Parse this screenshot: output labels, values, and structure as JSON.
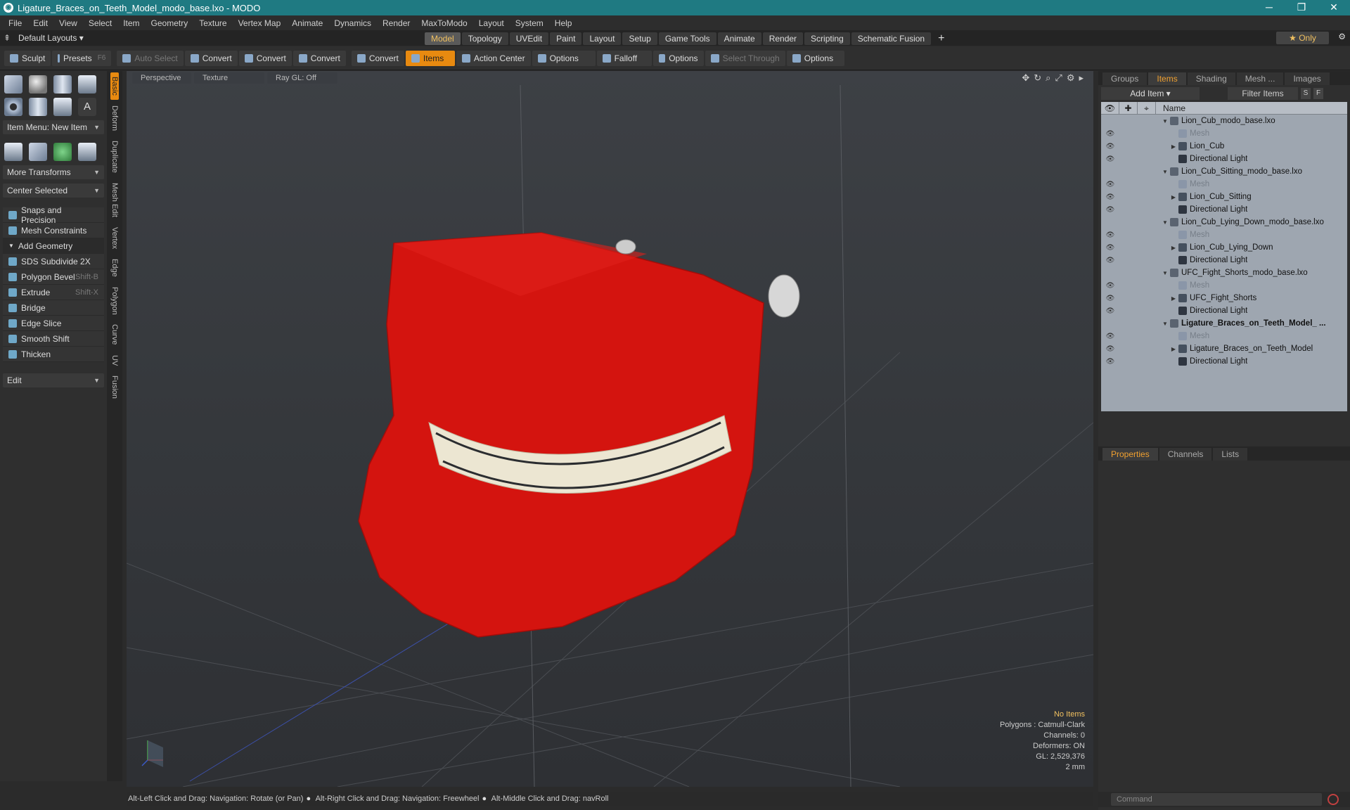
{
  "window": {
    "title": "Ligature_Braces_on_Teeth_Model_modo_base.lxo - MODO"
  },
  "menu": [
    "File",
    "Edit",
    "View",
    "Select",
    "Item",
    "Geometry",
    "Texture",
    "Vertex Map",
    "Animate",
    "Dynamics",
    "Render",
    "MaxToModo",
    "Layout",
    "System",
    "Help"
  ],
  "layouts": {
    "default_label": "Default Layouts"
  },
  "tabs": [
    "Model",
    "Topology",
    "UVEdit",
    "Paint",
    "Layout",
    "Setup",
    "Game Tools",
    "Animate",
    "Render",
    "Scripting",
    "Schematic Fusion"
  ],
  "only_label": "Only",
  "toolbar": {
    "sculpt": "Sculpt",
    "presets": "Presets",
    "presets_hk": "F6",
    "auto_select": "Auto Select",
    "convert1": "Convert",
    "convert2": "Convert",
    "convert3": "Convert",
    "convert4": "Convert",
    "items": "Items",
    "action_center": "Action Center",
    "options1": "Options",
    "falloff": "Falloff",
    "options2": "Options",
    "select_through": "Select Through",
    "options3": "Options"
  },
  "left": {
    "item_menu": "Item Menu: New Item",
    "more_transforms": "More Transforms",
    "center_selected": "Center Selected",
    "snaps": "Snaps and Precision",
    "mesh_constraints": "Mesh Constraints",
    "add_geometry": "Add Geometry",
    "tools": [
      {
        "label": "SDS Subdivide 2X",
        "hk": ""
      },
      {
        "label": "Polygon Bevel",
        "hk": "Shift-B"
      },
      {
        "label": "Extrude",
        "hk": "Shift-X"
      },
      {
        "label": "Bridge",
        "hk": ""
      },
      {
        "label": "Edge Slice",
        "hk": ""
      },
      {
        "label": "Smooth Shift",
        "hk": ""
      },
      {
        "label": "Thicken",
        "hk": ""
      }
    ],
    "edit": "Edit"
  },
  "sidetabs": [
    "Basic",
    "Deform",
    "Duplicate",
    "Mesh Edit",
    "Vertex",
    "Edge",
    "Polygon",
    "Curve",
    "UV",
    "Fusion"
  ],
  "viewport": {
    "perspective": "Perspective",
    "texture": "Texture",
    "raygl": "Ray GL: Off",
    "info": {
      "no_items": "No Items",
      "polygons": "Polygons : Catmull-Clark",
      "channels": "Channels: 0",
      "deformers": "Deformers: ON",
      "gl": "GL: 2,529,376",
      "scale": "2 mm"
    }
  },
  "status": {
    "a": "Alt-Left Click and Drag: Navigation: Rotate (or Pan)",
    "b": "Alt-Right Click and Drag: Navigation: Freewheel",
    "c": "Alt-Middle Click and Drag: navRoll"
  },
  "right": {
    "tabs": [
      "Groups",
      "Items",
      "Shading",
      "Mesh ...",
      "Images"
    ],
    "add_item": "Add Item",
    "filter": "Filter Items",
    "s": "S",
    "f": "F",
    "name_header": "Name",
    "rows": [
      {
        "label": "Lion_Cub_modo_base.lxo",
        "type": "scene",
        "indent": 0,
        "exp": "▼"
      },
      {
        "label": "Mesh",
        "type": "mesh",
        "indent": 1,
        "exp": ""
      },
      {
        "label": "Lion_Cub",
        "type": "loc",
        "indent": 1,
        "exp": "▶"
      },
      {
        "label": "Directional Light",
        "type": "light",
        "indent": 1,
        "exp": ""
      },
      {
        "label": "Lion_Cub_Sitting_modo_base.lxo",
        "type": "scene",
        "indent": 0,
        "exp": "▼"
      },
      {
        "label": "Mesh",
        "type": "mesh",
        "indent": 1,
        "exp": ""
      },
      {
        "label": "Lion_Cub_Sitting",
        "type": "loc",
        "indent": 1,
        "exp": "▶"
      },
      {
        "label": "Directional Light",
        "type": "light",
        "indent": 1,
        "exp": ""
      },
      {
        "label": "Lion_Cub_Lying_Down_modo_base.lxo",
        "type": "scene",
        "indent": 0,
        "exp": "▼"
      },
      {
        "label": "Mesh",
        "type": "mesh",
        "indent": 1,
        "exp": ""
      },
      {
        "label": "Lion_Cub_Lying_Down",
        "type": "loc",
        "indent": 1,
        "exp": "▶"
      },
      {
        "label": "Directional Light",
        "type": "light",
        "indent": 1,
        "exp": ""
      },
      {
        "label": "UFC_Fight_Shorts_modo_base.lxo",
        "type": "scene",
        "indent": 0,
        "exp": "▼"
      },
      {
        "label": "Mesh",
        "type": "mesh",
        "indent": 1,
        "exp": ""
      },
      {
        "label": "UFC_Fight_Shorts",
        "type": "loc",
        "indent": 1,
        "exp": "▶"
      },
      {
        "label": "Directional Light",
        "type": "light",
        "indent": 1,
        "exp": ""
      },
      {
        "label": "Ligature_Braces_on_Teeth_Model_ ...",
        "type": "scene",
        "indent": 0,
        "exp": "▼",
        "bold": true
      },
      {
        "label": "Mesh",
        "type": "mesh",
        "indent": 1,
        "exp": ""
      },
      {
        "label": "Ligature_Braces_on_Teeth_Model",
        "type": "loc",
        "indent": 1,
        "exp": "▶"
      },
      {
        "label": "Directional Light",
        "type": "light",
        "indent": 1,
        "exp": ""
      }
    ],
    "ptabs": [
      "Properties",
      "Channels",
      "Lists"
    ],
    "command_placeholder": "Command"
  }
}
